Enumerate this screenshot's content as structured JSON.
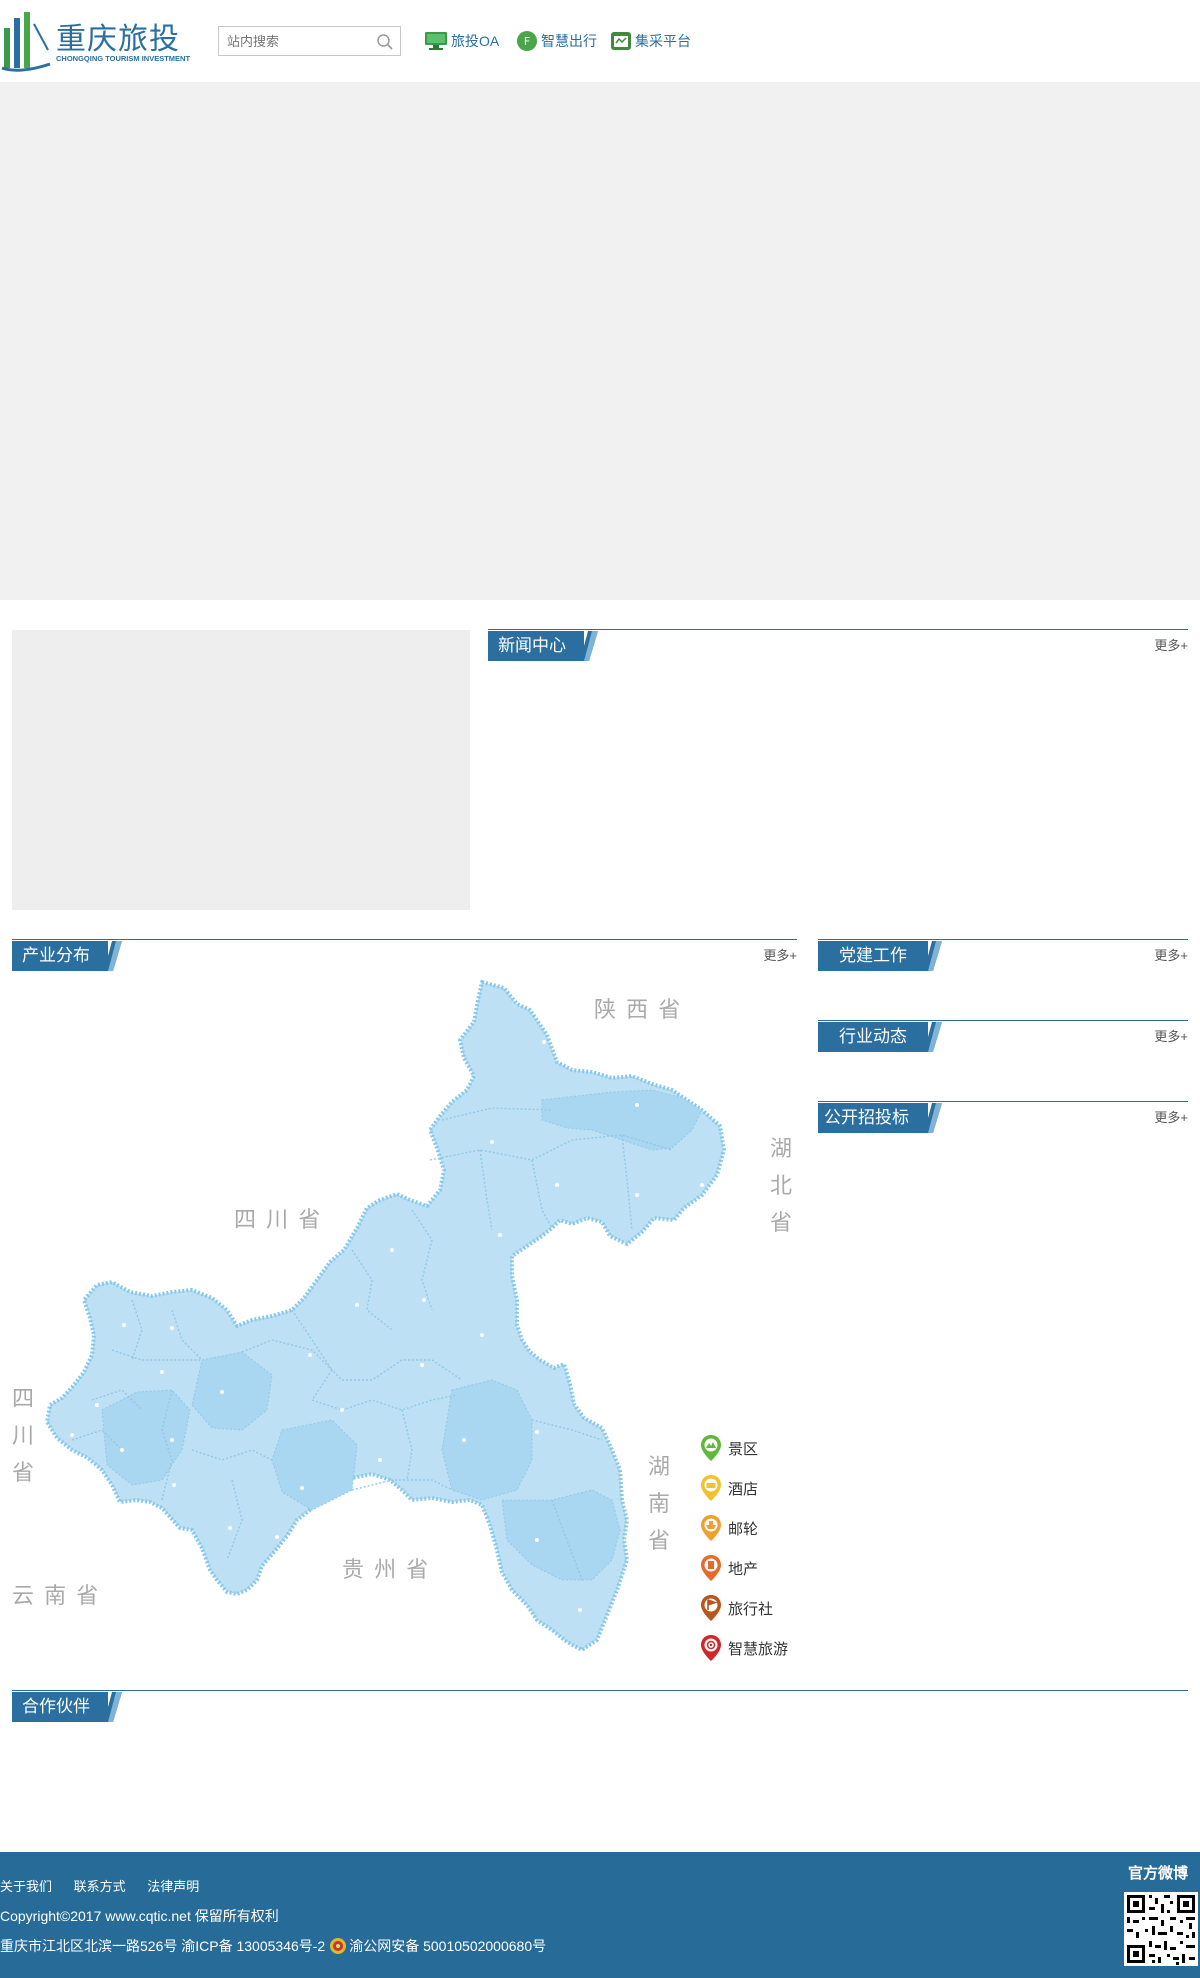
{
  "header": {
    "logo_cn": "重庆旅投",
    "logo_en": "CHONGQING TOURISM INVESTMENT",
    "search_placeholder": "站内搜索",
    "links": [
      {
        "label": "旅投OA",
        "icon": "monitor-icon",
        "color": "#3a9a4a"
      },
      {
        "label": "智慧出行",
        "icon": "smart-travel-icon",
        "color": "#4aa64a"
      },
      {
        "label": "集采平台",
        "icon": "procurement-icon",
        "color": "#3f8a3f"
      }
    ]
  },
  "news": {
    "title": "新闻中心",
    "more": "更多+"
  },
  "industry": {
    "title": "产业分布",
    "more": "更多+",
    "provinces": {
      "shaanxi": "陕 西 省",
      "sichuan_north": "四 川 省",
      "hubei": [
        "湖",
        "北",
        "省"
      ],
      "sichuan_west": [
        "四",
        "川",
        "省"
      ],
      "hunan": [
        "湖",
        "南",
        "省"
      ],
      "guizhou": "贵 州 省",
      "yunnan": "云 南 省"
    },
    "legend": [
      {
        "label": "景区",
        "icon": "scenic-pin-icon",
        "color": "#5fb83a"
      },
      {
        "label": "酒店",
        "icon": "hotel-pin-icon",
        "color": "#f2c12e"
      },
      {
        "label": "邮轮",
        "icon": "cruise-pin-icon",
        "color": "#f0a030"
      },
      {
        "label": "地产",
        "icon": "estate-pin-icon",
        "color": "#e86a2a"
      },
      {
        "label": "旅行社",
        "icon": "travel-agency-pin-icon",
        "color": "#b8561e"
      },
      {
        "label": "智慧旅游",
        "icon": "smart-tourism-pin-icon",
        "color": "#d0282a"
      }
    ]
  },
  "party": {
    "title": "党建工作",
    "more": "更多+"
  },
  "industry_news": {
    "title": "行业动态",
    "more": "更多+"
  },
  "tender": {
    "title": "公开招投标",
    "more": "更多+"
  },
  "partners": {
    "title": "合作伙伴"
  },
  "footer": {
    "links": [
      "关于我们",
      "联系方式",
      "法律声明"
    ],
    "copyright": "Copyright©2017 www.cqtic.net 保留所有权利",
    "address": "重庆市江北区北滨一路526号 渝ICP备 13005346号-2",
    "police": "渝公网安备 50010502000680号",
    "weibo": "官方微博"
  },
  "colors": {
    "brand": "#2a6fa0",
    "footer": "#276c98",
    "map_fill": "#b9def3",
    "map_border": "#7fc3ea"
  }
}
